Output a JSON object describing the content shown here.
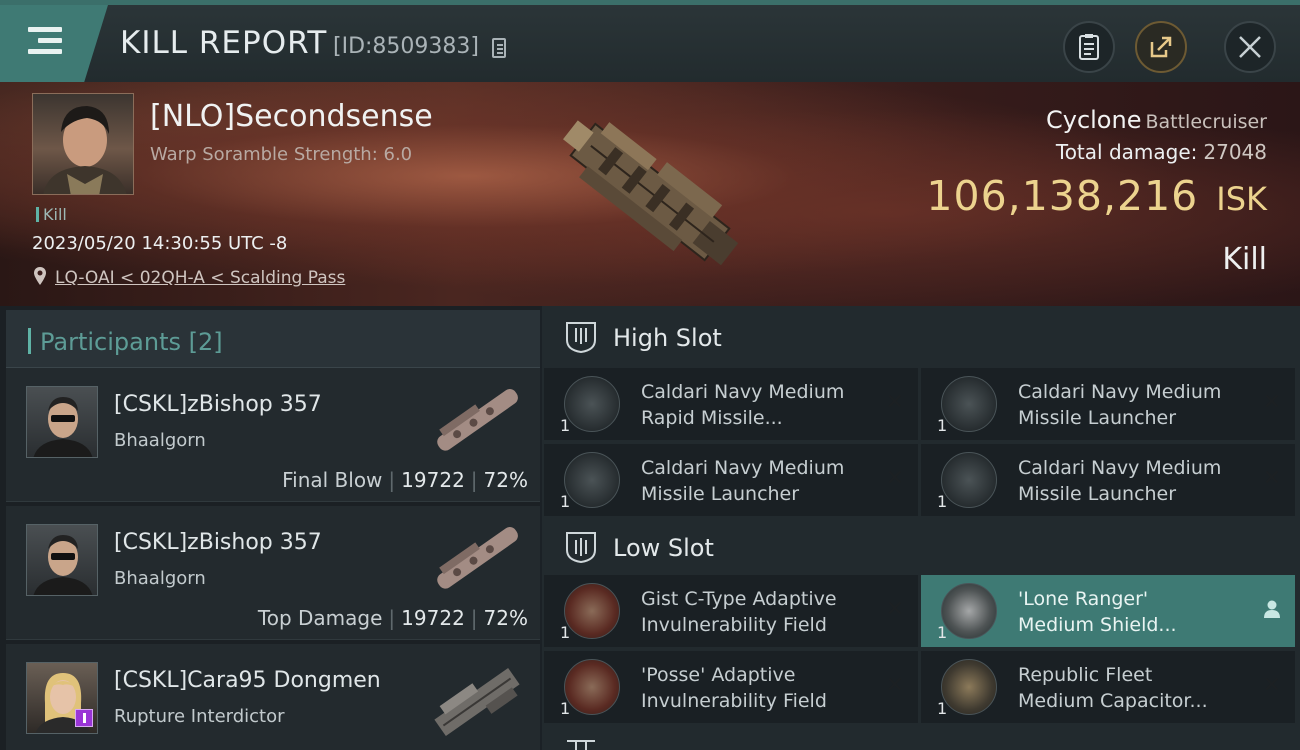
{
  "header": {
    "title": "KILL REPORT",
    "report_id": "[ID:8509383]"
  },
  "victim": {
    "pilot": "[NLO]Secondsense",
    "warp_scramble": "Warp Soramble Strength: 6.0",
    "tag": "Kill",
    "datetime": "2023/05/20 14:30:55 UTC -8",
    "location": "LQ-OAI < 02QH-A < Scalding Pass",
    "ship_name": "Cyclone",
    "ship_class": "Battlecruiser",
    "total_damage_label": "Total damage:",
    "total_damage": "27048",
    "isk_value": "106,138,216",
    "isk_unit": "ISK",
    "result": "Kill"
  },
  "participants": {
    "title": "Participants",
    "count": "[2]",
    "rows": [
      {
        "name": "[CSKL]zBishop 357",
        "ship": "Bhaalgorn",
        "role": "Final Blow",
        "damage": "19722",
        "percent": "72%"
      },
      {
        "name": "[CSKL]zBishop 357",
        "ship": "Bhaalgorn",
        "role": "Top Damage",
        "damage": "19722",
        "percent": "72%"
      },
      {
        "name": "[CSKL]Cara95 Dongmen",
        "ship": "Rupture Interdictor"
      }
    ]
  },
  "fitting": {
    "high_slot": {
      "label": "High Slot",
      "modules": [
        {
          "line1": "Caldari Navy Medium",
          "line2": "Rapid Missile...",
          "qty": "1",
          "icon": "rapid-missile-launcher-icon"
        },
        {
          "line1": "Caldari Navy Medium",
          "line2": "Missile Launcher",
          "qty": "1",
          "icon": "missile-launcher-icon"
        },
        {
          "line1": "Caldari Navy Medium",
          "line2": "Missile Launcher",
          "qty": "1",
          "icon": "missile-launcher-icon"
        },
        {
          "line1": "Caldari Navy Medium",
          "line2": "Missile Launcher",
          "qty": "1",
          "icon": "missile-launcher-icon"
        }
      ]
    },
    "low_slot": {
      "label": "Low Slot",
      "modules": [
        {
          "line1": "Gist C-Type Adaptive",
          "line2": "Invulnerability Field",
          "qty": "1",
          "icon": "invulnerability-field-icon"
        },
        {
          "line1": "'Lone Ranger'",
          "line2": "Medium Shield...",
          "qty": "1",
          "icon": "shield-extender-icon",
          "highlighted": true
        },
        {
          "line1": "'Posse' Adaptive",
          "line2": "Invulnerability Field",
          "qty": "1",
          "icon": "invulnerability-field-icon"
        },
        {
          "line1": "Republic Fleet",
          "line2": "Medium Capacitor...",
          "qty": "1",
          "icon": "capacitor-booster-icon"
        }
      ]
    }
  },
  "colors": {
    "accent": "#3f7a74",
    "isk": "#ecd38e",
    "participants_title": "#5d9c96"
  }
}
